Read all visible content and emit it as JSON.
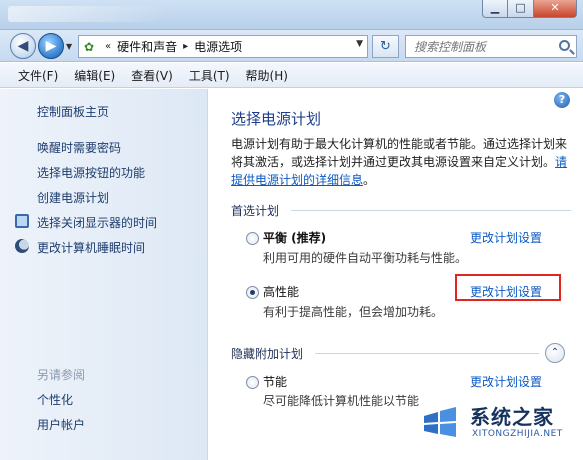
{
  "window": {
    "minimize_glyph": "▁",
    "maximize_glyph": "□",
    "close_glyph": "✕"
  },
  "address": {
    "back_glyph": "◀",
    "forward_glyph": "▶",
    "overflow": "«",
    "separator": "▸",
    "crumbs": [
      "硬件和声音",
      "电源选项"
    ],
    "refresh_glyph": "↻",
    "search_placeholder": "搜索控制面板"
  },
  "menu": [
    "文件(F)",
    "编辑(E)",
    "查看(V)",
    "工具(T)",
    "帮助(H)"
  ],
  "sidebar": {
    "home": "控制面板主页",
    "links": [
      "唤醒时需要密码",
      "选择电源按钮的功能",
      "创建电源计划",
      "选择关闭显示器的时间",
      "更改计算机睡眠时间"
    ],
    "see_also_heading": "另请参阅",
    "see_also": [
      "个性化",
      "用户帐户"
    ]
  },
  "main": {
    "help_glyph": "?",
    "title": "选择电源计划",
    "description": "电源计划有助于最大化计算机的性能或者节能。通过选择计划来将其激活，或选择计划并通过更改其电源设置来自定义计划。",
    "description_link": "请提供电源计划的详细信息",
    "description_end": "。",
    "preferred_heading": "首选计划",
    "hidden_heading": "隐藏附加计划",
    "expand_glyph": "⌃",
    "plans": [
      {
        "name": "平衡 (推荐)",
        "desc": "利用可用的硬件自动平衡功耗与性能。",
        "selected": false,
        "link": "更改计划设置"
      },
      {
        "name": "高性能",
        "desc": "有利于提高性能，但会增加功耗。",
        "selected": true,
        "link": "更改计划设置"
      },
      {
        "name": "节能",
        "desc": "尽可能降低计算机性能以节能",
        "selected": false,
        "link": "更改计划设置"
      }
    ]
  },
  "watermark": {
    "title": "系统之家",
    "url": "XITONGZHIJIA.NET"
  },
  "colors": {
    "highlight": "#e0261f",
    "link": "#0b5ac2",
    "title": "#1c3e8a"
  }
}
